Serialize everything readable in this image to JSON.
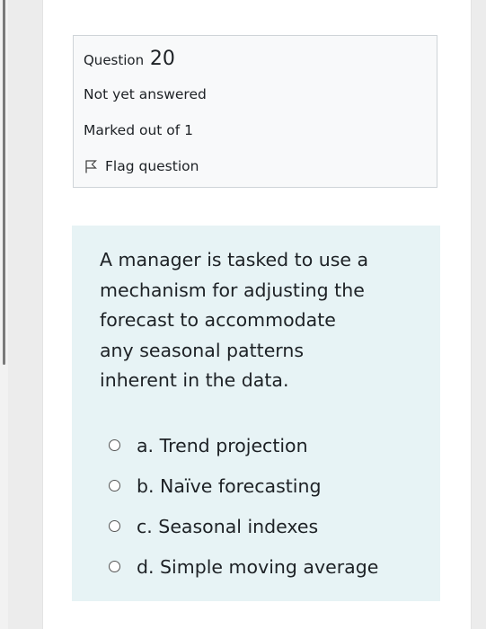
{
  "question_info": {
    "question_label": "Question",
    "question_number": "20",
    "state": "Not yet answered",
    "grade": "Marked out of 1",
    "flag_label": "Flag question"
  },
  "formulation": {
    "question_text_lines": [
      "A manager is tasked to use a",
      "mechanism for adjusting the",
      "forecast to accommodate",
      "any seasonal patterns",
      "inherent in the data."
    ],
    "answers": [
      {
        "label": "a. Trend projection",
        "selected": false
      },
      {
        "label": "b. Naïve forecasting",
        "selected": false
      },
      {
        "label": "c. Seasonal indexes",
        "selected": false
      },
      {
        "label": "d. Simple moving average",
        "selected": false
      }
    ]
  },
  "icons": {
    "flag": "flag-outline-icon",
    "radio": "radio-unchecked-icon"
  },
  "colors": {
    "info_background": "#f8f9fa",
    "info_border": "#cfd4d8",
    "formulation_background": "#e7f3f5",
    "text": "#1d2125"
  }
}
